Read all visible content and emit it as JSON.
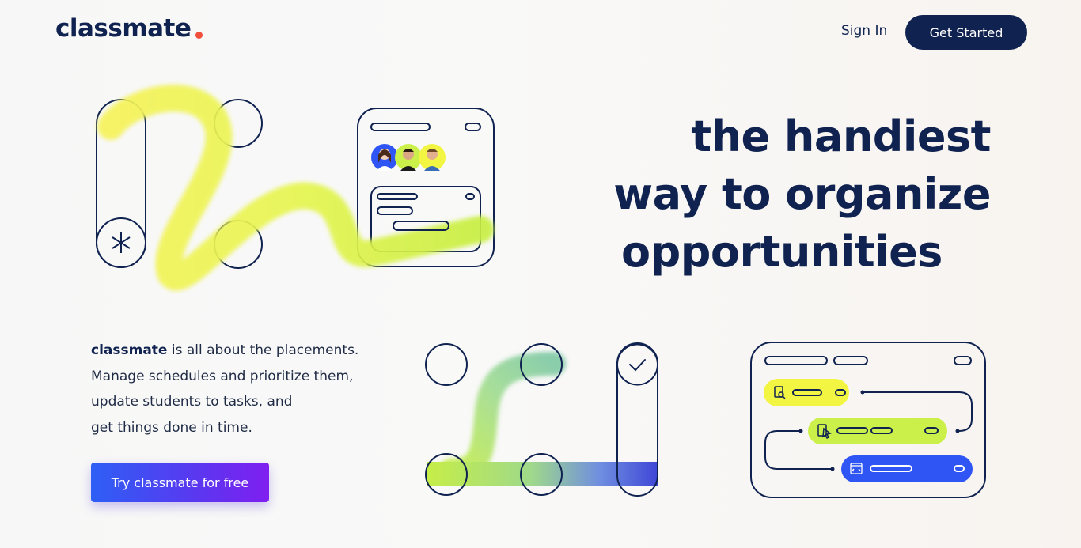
{
  "brand": {
    "name": "classmate",
    "dot_color": "#f0503c"
  },
  "nav": {
    "signin_label": "Sign In",
    "getstarted_label": "Get Started"
  },
  "hero": {
    "headline_line1": "the handiest",
    "headline_line2": "way to organize",
    "headline_line3": "opportunities"
  },
  "about": {
    "brand_word": "classmate",
    "line1_rest": " is all about the placements.",
    "line2": "Manage schedules and prioritize them,",
    "line3": "update students to tasks, and",
    "line4": "get things done in time."
  },
  "cta": {
    "label": "Try classmate for free"
  },
  "colors": {
    "navy": "#0f2250",
    "accent_yellow": "#f2f542",
    "accent_lime": "#cbf04a",
    "accent_blue": "#2f55f4",
    "cta_gradient_start": "#2e5ff5",
    "cta_gradient_end": "#7f1ff0"
  },
  "icons": [
    "asterisk-icon",
    "check-icon",
    "search-doc-icon",
    "pointer-doc-icon",
    "code-window-icon"
  ]
}
